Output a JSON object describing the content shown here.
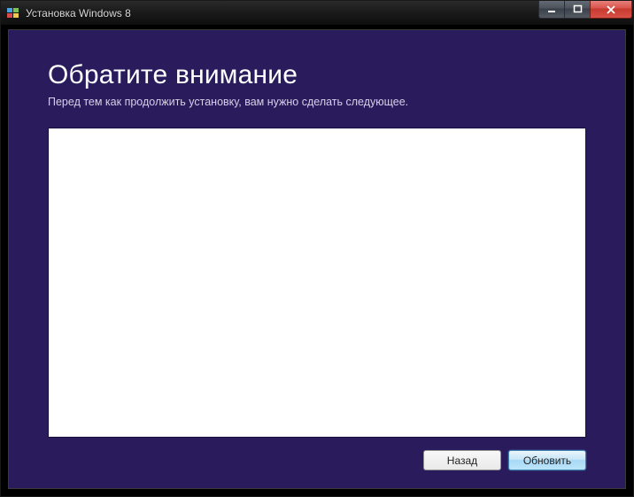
{
  "window": {
    "title": "Установка Windows 8"
  },
  "page": {
    "heading": "Обратите внимание",
    "subtext": "Перед тем как продолжить установку, вам нужно сделать следующее."
  },
  "buttons": {
    "back": "Назад",
    "refresh": "Обновить"
  }
}
